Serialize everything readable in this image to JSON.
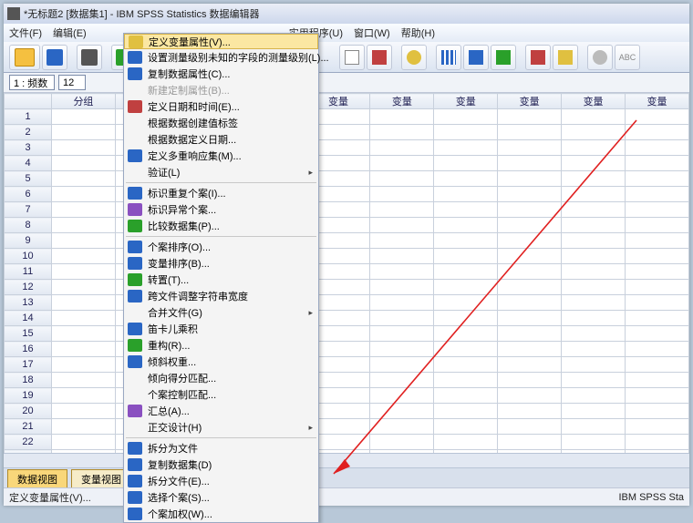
{
  "title": "*无标题2 [数据集1] - IBM SPSS Statistics 数据编辑器",
  "menubar": {
    "file": "文件(F)",
    "edit": "编辑(E)",
    "util": "实用程序(U)",
    "window": "窗口(W)",
    "help": "帮助(H)"
  },
  "rowinfo": {
    "label": "1 : 频数",
    "value": "12"
  },
  "col1": "分组",
  "varlabel": "变量",
  "rows": 24,
  "tabs": {
    "data": "数据视图",
    "var": "变量视图"
  },
  "status": {
    "left": "定义变量属性(V)...",
    "right": "IBM SPSS Sta"
  },
  "dd": [
    {
      "t": "定义变量属性(V)...",
      "ic": "yel",
      "hl": true
    },
    {
      "t": "设置测量级别未知的字段的测量级别(L)...",
      "ic": "blue"
    },
    {
      "t": "复制数据属性(C)...",
      "ic": "blue"
    },
    {
      "t": "新建定制属性(B)...",
      "ic": "",
      "dis": true
    },
    {
      "t": "定义日期和时间(E)...",
      "ic": "red"
    },
    {
      "t": "根据数据创建值标签"
    },
    {
      "t": "根据数据定义日期..."
    },
    {
      "t": "定义多重响应集(M)...",
      "ic": "blue"
    },
    {
      "t": "验证(L)",
      "sub": true
    },
    {
      "sep": true
    },
    {
      "t": "标识重复个案(I)...",
      "ic": "blue"
    },
    {
      "t": "标识异常个案...",
      "ic": "pur"
    },
    {
      "t": "比较数据集(P)...",
      "ic": "grn"
    },
    {
      "sep": true
    },
    {
      "t": "个案排序(O)...",
      "ic": "blue"
    },
    {
      "t": "变量排序(B)...",
      "ic": "blue"
    },
    {
      "t": "转置(T)...",
      "ic": "grn"
    },
    {
      "t": "跨文件调整字符串宽度",
      "ic": "blue"
    },
    {
      "t": "合并文件(G)",
      "sub": true
    },
    {
      "t": "笛卡儿乘积",
      "ic": "blue"
    },
    {
      "t": "重构(R)...",
      "ic": "grn"
    },
    {
      "t": "倾斜权重...",
      "ic": "blue"
    },
    {
      "t": "倾向得分匹配..."
    },
    {
      "t": "个案控制匹配..."
    },
    {
      "t": "汇总(A)...",
      "ic": "pur"
    },
    {
      "t": "正交设计(H)",
      "sub": true
    },
    {
      "sep": true
    },
    {
      "t": "拆分为文件",
      "ic": "blue"
    },
    {
      "t": "复制数据集(D)",
      "ic": "blue"
    },
    {
      "t": "拆分文件(E)...",
      "ic": "blue"
    },
    {
      "t": "选择个案(S)...",
      "ic": "blue"
    },
    {
      "t": "个案加权(W)...",
      "ic": "blue"
    }
  ]
}
